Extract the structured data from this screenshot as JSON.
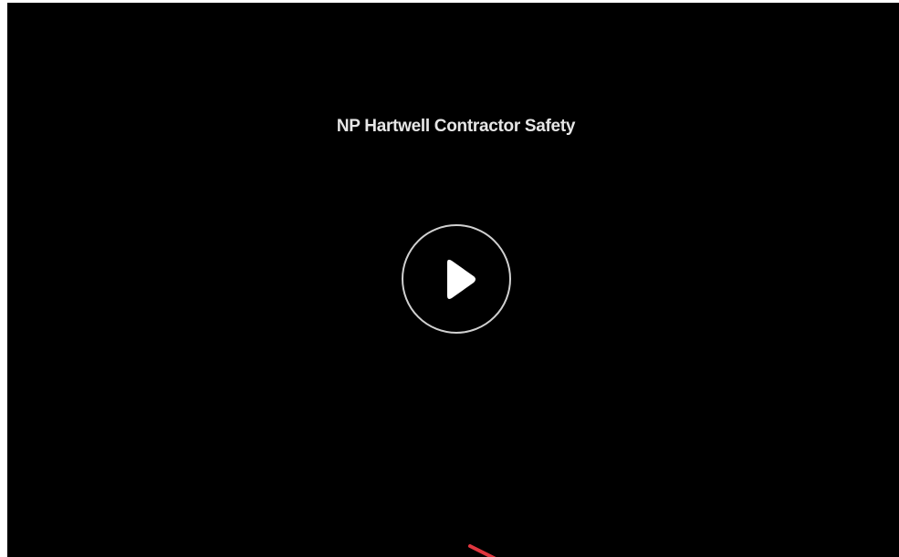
{
  "video": {
    "title": "NP Hartwell Contractor Safety",
    "play_icon": "play-icon",
    "accent_line_color": "#e0363f"
  }
}
